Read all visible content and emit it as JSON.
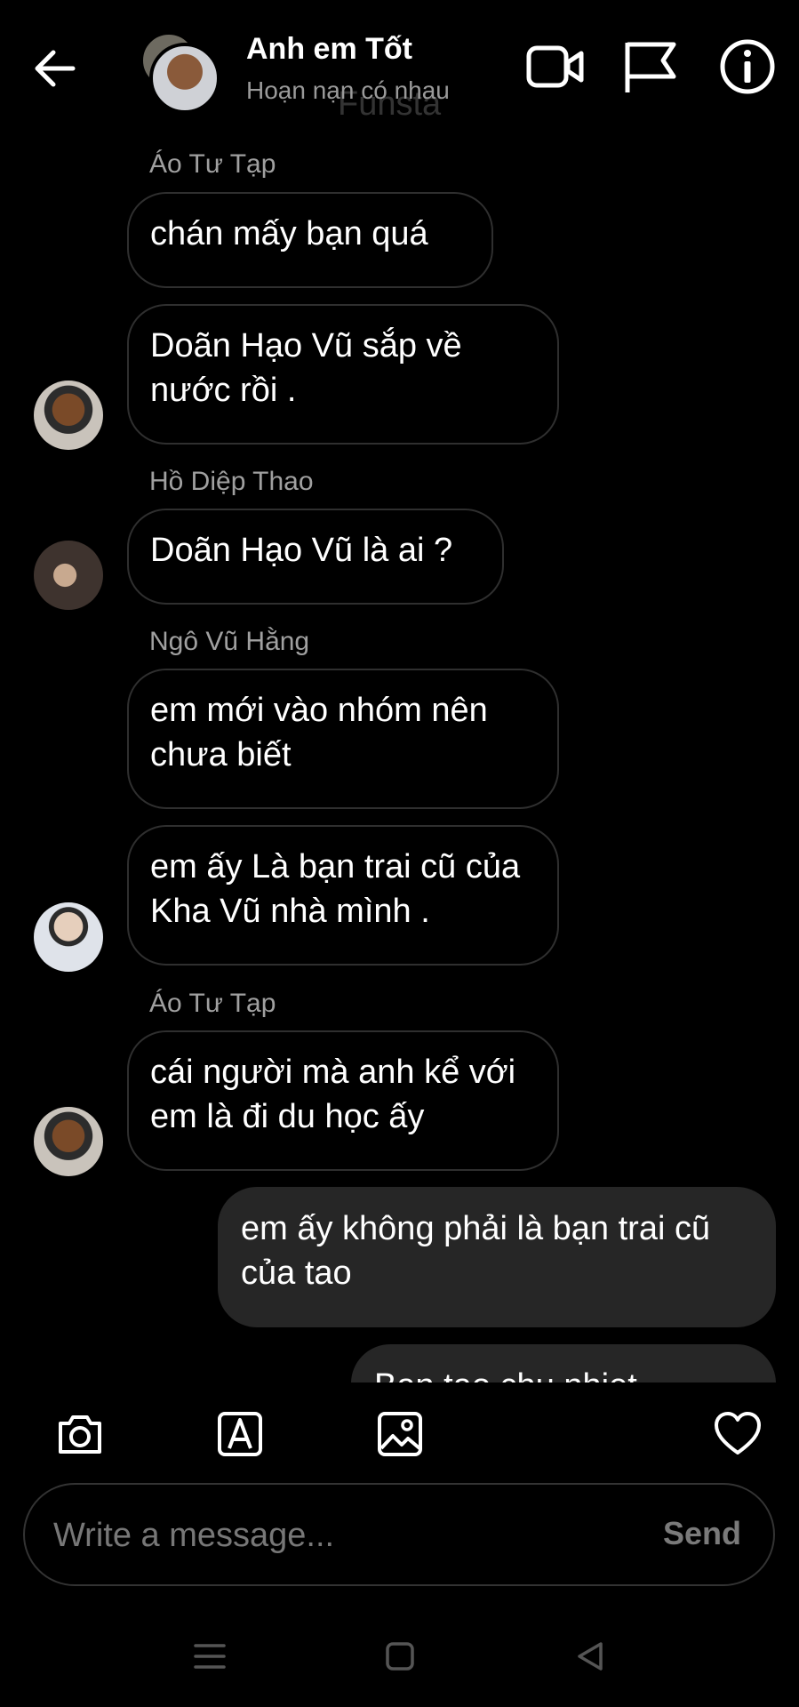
{
  "header": {
    "title": "Anh em Tốt",
    "subtitle": "Hoạn nạn có nhau",
    "ghost_text": "Funsta"
  },
  "messages": [
    {
      "sender": "Áo Tư Tạp",
      "text": "chán mấy bạn quá"
    },
    {
      "text": "Doãn Hạo Vũ sắp về nước rồi ."
    },
    {
      "sender": "Hồ Diệp Thao",
      "text": "Doãn Hạo Vũ là ai ?"
    },
    {
      "sender": "Ngô Vũ Hằng",
      "text": "em mới vào nhóm nên chưa biết"
    },
    {
      "text": "em ấy Là bạn trai cũ của Kha Vũ nhà mình ."
    },
    {
      "sender": "Áo Tư Tạp",
      "text": "cái người mà anh kể với em là đi du học ấy"
    },
    {
      "text": "em ấy không phải là bạn trai cũ của tao"
    },
    {
      "text": "Ban tao chu nhiet"
    }
  ],
  "composer": {
    "placeholder": "Write a message...",
    "send_label": "Send"
  },
  "colors": {
    "background": "#000000",
    "incoming_border": "#2f2f2f",
    "outgoing_bg": "#262626",
    "meta_text": "#a0a0a0"
  }
}
